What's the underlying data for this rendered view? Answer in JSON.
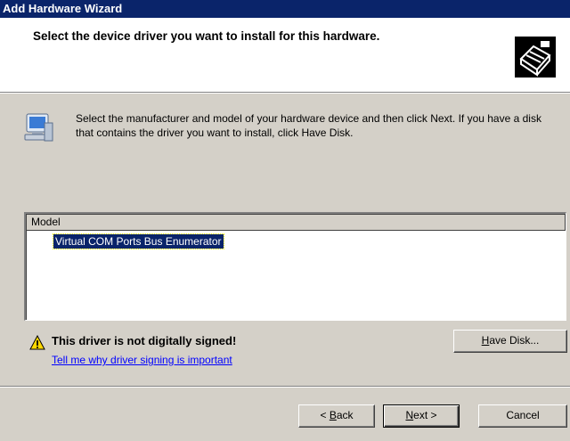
{
  "window": {
    "title": "Add Hardware Wizard"
  },
  "header": {
    "title": "Select the device driver you want to install for this hardware.",
    "icon": "hardware-wizard-icon"
  },
  "instruction": {
    "icon": "computer-icon",
    "text": "Select the manufacturer and model of your hardware device and then click Next. If you have a disk that contains the driver you want to install, click Have Disk."
  },
  "model_list": {
    "column_header": "Model",
    "items": [
      "Virtual COM Ports Bus Enumerator"
    ],
    "selected_index": 0
  },
  "warning": {
    "icon": "warning-icon",
    "text": "This driver is not digitally signed!",
    "link": "Tell me why driver signing is important"
  },
  "buttons": {
    "have_disk_prefix": "",
    "have_disk_accel": "H",
    "have_disk_rest": "ave Disk...",
    "back_prefix": "< ",
    "back_accel": "B",
    "back_rest": "ack",
    "next_accel": "N",
    "next_rest": "ext >",
    "cancel": "Cancel"
  },
  "colors": {
    "titlebar": "#0a246a",
    "dialog_bg": "#d4d0c8",
    "selection": "#0a246a",
    "link": "#0000ff"
  }
}
